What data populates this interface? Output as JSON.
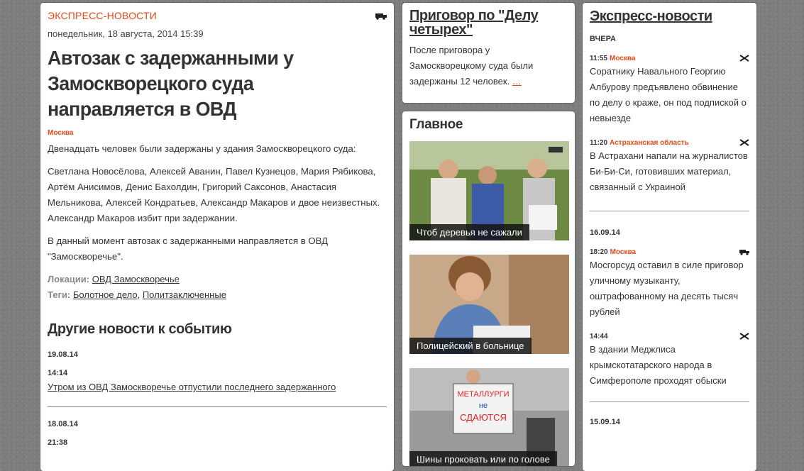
{
  "article": {
    "kicker": "ЭКСПРЕСС-НОВОСТИ",
    "date": "понедельник, 18 августа, 2014 15:39",
    "title": "Автозак с задержанными у Замоскворецкого суда направляется в ОВД",
    "location": "Москва",
    "p1": "Двенадцать человек были задержаны у здания Замоскворецкого суда:",
    "p2": "Светлана Новосёлова, Алексей Аванин, Павел Кузнецов, Мария Рябикова, Артём Анисимов, Денис Бахолдин, Григорий Саксонов, Анастасия Мельникова, Алексей Кондратьев, Александр Макаров и двое неизвестных. Александр Макаров избит при задержании.",
    "p3": "В данный момент автозак с задержанными направляется в ОВД \"Замоскворечье\".",
    "locations_label": "Локации:",
    "locations_value": "ОВД Замоскворечье",
    "tags_label": "Теги:",
    "tag1": "Болотное дело",
    "tag2": "Политзаключенные",
    "other_title": "Другие новости к событию",
    "e1_date": "19.08.14",
    "e1_time": "14:14",
    "e1_link": "Утром из ОВД Замоскворечье отпустили последнего задержанного",
    "e2_date": "18.08.14",
    "e2_time": "21:38"
  },
  "verdict": {
    "title": "Приговор по \"Делу четырех\"",
    "text": "После приговора у Замоскворецкому суда были задержаны 12 человек.",
    "more": "…"
  },
  "main": {
    "title": "Главное",
    "cards": [
      {
        "caption": "Чтоб деревья не сажали"
      },
      {
        "caption": "Полицейский в больнице"
      },
      {
        "caption": "Шины проковать или по голове"
      }
    ],
    "sign_line1": "МЕТАЛЛУРГИ",
    "sign_line2": "не",
    "sign_line3": "СДАЮТСЯ"
  },
  "express": {
    "title": "Экспресс-новости",
    "day1": "ВЧЕРА",
    "items1": [
      {
        "time": "11:55",
        "region": "Москва",
        "text": "Соратнику Навального Георгию Албурову предъявлено обвинение по делу о краже, он под подпиской о невыезде",
        "icon": "crossed-hammers-icon"
      },
      {
        "time": "11:20",
        "region": "Астраханская область",
        "text": "В Астрахани напали на журналистов Би-Би-Си, готовивших материал, связанный с Украиной",
        "icon": "crossed-hammers-icon"
      }
    ],
    "day2": "16.09.14",
    "items2": [
      {
        "time": "18:20",
        "region": "Москва",
        "text": "Мосгорсуд оставил в силе приговор уличному музыканту, оштрафованному на десять тысяч рублей",
        "icon": "police-van-icon"
      },
      {
        "time": "14:44",
        "region": "",
        "text": "В здании Меджлиса крымскотатарского народа в Симферополе проходят обыски",
        "icon": "crossed-hammers-icon"
      }
    ],
    "day3": "15.09.14"
  }
}
